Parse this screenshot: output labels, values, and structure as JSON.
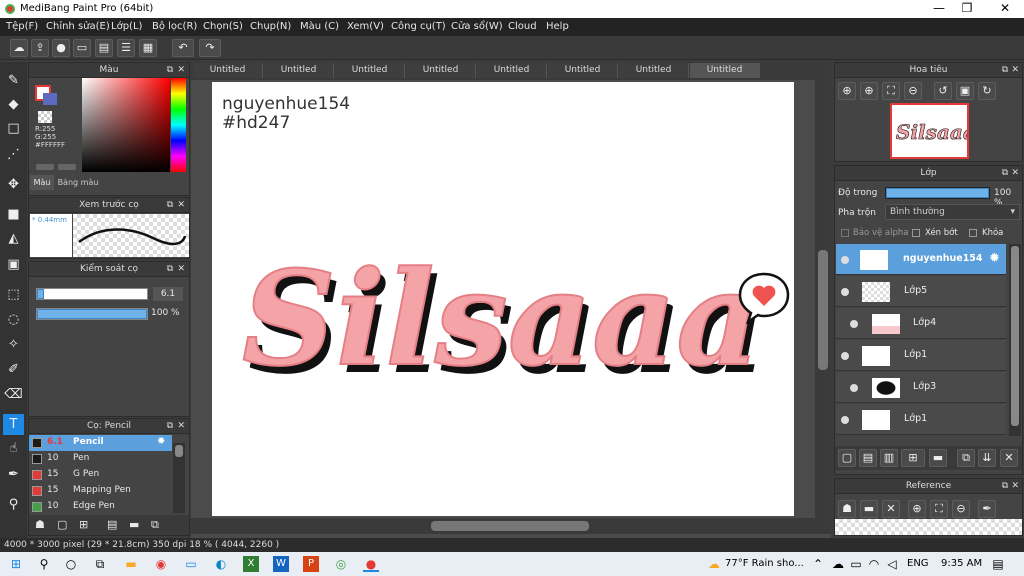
{
  "window": {
    "title": "MediBang Paint Pro (64bit)",
    "minimize": "—",
    "maximize": "❐",
    "close": "✕"
  },
  "menu": [
    "Tệp(F)",
    "Chỉnh sửa(E)",
    "Lớp(L)",
    "Bộ lọc(R)",
    "Chọn(S)",
    "Chụp(N)",
    "Màu (C)",
    "Xem(V)",
    "Công cụ(T)",
    "Cửa sổ(W)",
    "Cloud",
    "Help"
  ],
  "toolbar": {
    "icons": [
      "cloud-icon",
      "share-icon",
      "comment-icon",
      "panel-icon",
      "doc-icon",
      "list-icon",
      "grid-icon"
    ],
    "undo": "↶",
    "redo": "↷"
  },
  "tools": [
    "brush-icon",
    "eraser-icon",
    "rectangle-icon",
    "dotline-icon",
    "move-icon",
    "fill-rect-icon",
    "bucket-icon",
    "gradient-icon",
    "select-rect-icon",
    "lasso-icon",
    "magic-wand-icon",
    "select-pen-icon",
    "select-eraser-icon",
    "text-icon",
    "operation-icon",
    "eyedropper-icon",
    "dropper-icon"
  ],
  "color_panel": {
    "title": "Màu",
    "r": "R:255",
    "g": "G:255",
    "b": "B:255",
    "hex": "#FFFFFF",
    "tab_color": "Màu",
    "tab_palette": "Bảng màu"
  },
  "brush_preview": {
    "title": "Xem trước cọ",
    "size": "* 0.44mm"
  },
  "brush_control": {
    "title": "Kiểm soát cọ",
    "size_value": "6.1",
    "opacity_value": "100 %",
    "size_fraction": 0.06,
    "opacity_fraction": 1.0
  },
  "brush_list": {
    "title": "Cọ: Pencil",
    "items": [
      {
        "size": "6.1",
        "name": "Pencil",
        "color": "#1a1a1a",
        "selected": true
      },
      {
        "size": "10",
        "name": "Pen",
        "color": "#1a1a1a",
        "selected": false
      },
      {
        "size": "15",
        "name": "G Pen",
        "color": "#e53935",
        "selected": false
      },
      {
        "size": "15",
        "name": "Mapping Pen",
        "color": "#e53935",
        "selected": false
      },
      {
        "size": "10",
        "name": "Edge Pen",
        "color": "#43a047",
        "selected": false
      }
    ]
  },
  "tabs": [
    "Untitled",
    "Untitled",
    "Untitled",
    "Untitled",
    "Untitled",
    "Untitled",
    "Untitled",
    "Untitled"
  ],
  "canvas": {
    "line1": "nguyenhue154",
    "line2": "#hd247",
    "art_text": "Silsaaa"
  },
  "navigator": {
    "title": "Hoa tiêu"
  },
  "layers": {
    "title": "Lớp",
    "opacity_label": "Độ trong",
    "opacity_value": "100 %",
    "opacity_fraction": 1.0,
    "blend_label": "Pha trộn",
    "blend_value": "Bình thường",
    "protect_alpha": "Bảo vệ alpha",
    "clipping": "Xén bớt",
    "lock": "Khóa",
    "items": [
      {
        "name": "nguyenhue154",
        "selected": true,
        "indent": false
      },
      {
        "name": "Lớp5",
        "selected": false,
        "indent": false
      },
      {
        "name": "Lớp4",
        "selected": false,
        "indent": true
      },
      {
        "name": "Lớp1",
        "selected": false,
        "indent": false
      },
      {
        "name": "Lớp3",
        "selected": false,
        "indent": true
      },
      {
        "name": "Lớp1",
        "selected": false,
        "indent": false
      }
    ]
  },
  "reference": {
    "title": "Reference"
  },
  "status": {
    "text": "4000 * 3000 pixel  (29 * 21.8cm)  350 dpi  18 %  ( 4044, 2260 )"
  },
  "taskbar": {
    "weather": "77°F  Rain sho...",
    "lang": "ENG",
    "time": "9:35 AM"
  }
}
